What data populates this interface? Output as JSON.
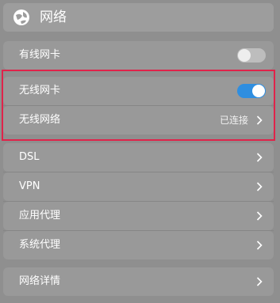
{
  "header": {
    "title": "网络",
    "logo": "network-globe-icon"
  },
  "wired_card": {
    "label": "有线网卡",
    "toggle_on": false
  },
  "wireless_card": {
    "label": "无线网卡",
    "toggle_on": true
  },
  "wireless_network": {
    "label": "无线网络",
    "status": "已连接"
  },
  "list_items": [
    {
      "label": "DSL"
    },
    {
      "label": "VPN"
    },
    {
      "label": "应用代理"
    },
    {
      "label": "系统代理"
    }
  ],
  "network_details": {
    "label": "网络详情"
  },
  "colors": {
    "background": "#8f8f8f",
    "row_bg": "#999999",
    "accent": "#2f8ee0",
    "highlight": "#e0234a"
  }
}
